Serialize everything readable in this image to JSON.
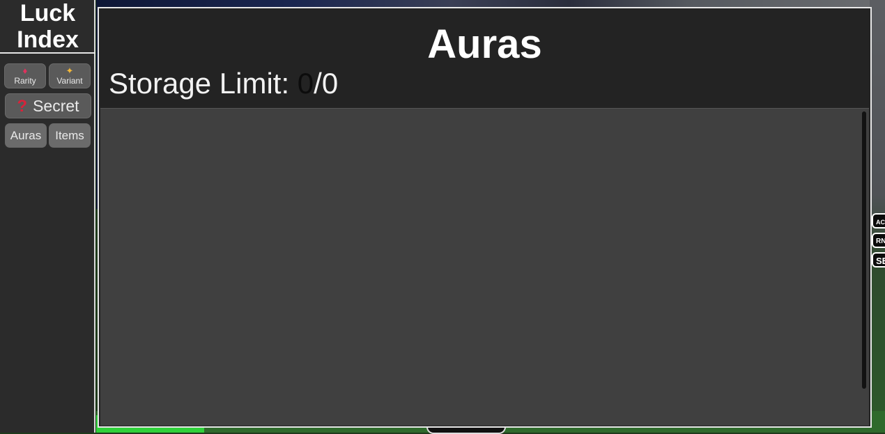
{
  "sidebar": {
    "title_line1": "Luck",
    "title_line2": "Index",
    "rarity": {
      "label": "Rarity",
      "icon": "dice-icon",
      "glyph": "♦"
    },
    "variant": {
      "label": "Variant",
      "icon": "sparkle-icon",
      "glyph": "✦"
    },
    "secret": {
      "label": "Secret",
      "icon": "question-mark-icon",
      "glyph": "?"
    },
    "auras": {
      "label": "Auras"
    },
    "items": {
      "label": "Items"
    }
  },
  "panel": {
    "title": "Auras",
    "storage_label": "Storage Limit: ",
    "storage_current": "0",
    "storage_max": "/0"
  },
  "edge_tags": [
    "AC",
    "RN",
    "SE"
  ]
}
